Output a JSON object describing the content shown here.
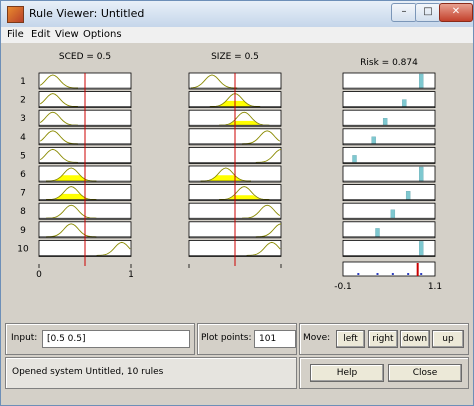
{
  "window": {
    "title": "Rule Viewer: Untitled"
  },
  "menu": [
    "File",
    "Edit",
    "View",
    "Options"
  ],
  "inputs": [
    {
      "name": "SCED",
      "header": "SCED = 0.5",
      "value": 0.5,
      "range": [
        0,
        1
      ],
      "tick_labels": [
        "0",
        "1"
      ]
    },
    {
      "name": "SIZE",
      "header": "SIZE = 0.5",
      "value": 0.5,
      "range": [
        0,
        1
      ],
      "tick_labels": [],
      "tick_values": [
        0,
        1
      ]
    }
  ],
  "output": {
    "name": "Risk",
    "header": "Risk = 0.874",
    "value": 0.874,
    "range": [
      -0.1,
      1.1
    ],
    "tick_labels": [
      "-0.1",
      "1.1"
    ]
  },
  "rules": [
    {
      "number": "1",
      "sced": {
        "center": 0.15,
        "fill": 0.0
      },
      "size": {
        "center": 0.25,
        "fill": 0.0
      },
      "out": 0.92,
      "out_fill": 1.0
    },
    {
      "number": "2",
      "sced": {
        "center": 0.15,
        "fill": 0.0
      },
      "size": {
        "center": 0.5,
        "fill": 0.8
      },
      "out": 0.7,
      "out_fill": 0.5
    },
    {
      "number": "3",
      "sced": {
        "center": 0.15,
        "fill": 0.0
      },
      "size": {
        "center": 0.6,
        "fill": 0.6
      },
      "out": 0.45,
      "out_fill": 0.5
    },
    {
      "number": "4",
      "sced": {
        "center": 0.15,
        "fill": 0.0
      },
      "size": {
        "center": 0.85,
        "fill": 0.0
      },
      "out": 0.3,
      "out_fill": 0.5
    },
    {
      "number": "5",
      "sced": {
        "center": 0.15,
        "fill": 0.0
      },
      "size": {
        "center": 1.0,
        "fill": 0.0
      },
      "out": 0.05,
      "out_fill": 0.5
    },
    {
      "number": "6",
      "sced": {
        "center": 0.35,
        "fill": 0.8
      },
      "size": {
        "center": 0.4,
        "fill": 0.8
      },
      "out": 0.92,
      "out_fill": 1.0
    },
    {
      "number": "7",
      "sced": {
        "center": 0.35,
        "fill": 0.8
      },
      "size": {
        "center": 0.6,
        "fill": 0.6
      },
      "out": 0.75,
      "out_fill": 0.6
    },
    {
      "number": "8",
      "sced": {
        "center": 0.35,
        "fill": 0.0
      },
      "size": {
        "center": 0.85,
        "fill": 0.0
      },
      "out": 0.55,
      "out_fill": 0.6
    },
    {
      "number": "9",
      "sced": {
        "center": 0.35,
        "fill": 0.0
      },
      "size": {
        "center": 1.0,
        "fill": 0.0
      },
      "out": 0.35,
      "out_fill": 0.6
    },
    {
      "number": "10",
      "sced": {
        "center": 0.9,
        "fill": 0.0
      },
      "size": {
        "center": 0.9,
        "fill": 0.0
      },
      "out": 0.92,
      "out_fill": 1.0
    }
  ],
  "controls": {
    "input_label": "Input:",
    "input_value": "[0.5 0.5]",
    "plot_points_label": "Plot points:",
    "plot_points_value": "101",
    "move_label": "Move:",
    "left": "left",
    "right": "right",
    "down": "down",
    "up": "up",
    "help": "Help",
    "close": "Close",
    "status": "Opened system Untitled, 10 rules"
  },
  "colors": {
    "mf_line": "#8a8a00",
    "mf_fill": "#ffff00",
    "out_bar": "#7ec8d0",
    "cursor": "#cc0000"
  }
}
